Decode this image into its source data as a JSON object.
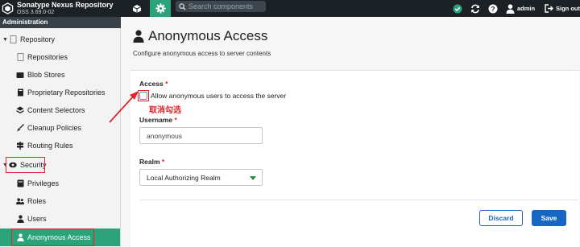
{
  "header": {
    "app_name": "Sonatype Nexus Repository",
    "version": "OSS 3.69.0-02",
    "search_placeholder": "Search components",
    "user_name": "admin",
    "signout_label": "Sign out"
  },
  "sidebar": {
    "section_title": "Administration",
    "items": [
      {
        "label": "Repository",
        "icon": "repository-icon"
      },
      {
        "label": "Repositories",
        "icon": "repositories-icon"
      },
      {
        "label": "Blob Stores",
        "icon": "blob-stores-icon"
      },
      {
        "label": "Proprietary Repositories",
        "icon": "proprietary-icon"
      },
      {
        "label": "Content Selectors",
        "icon": "content-selectors-icon"
      },
      {
        "label": "Cleanup Policies",
        "icon": "cleanup-icon"
      },
      {
        "label": "Routing Rules",
        "icon": "routing-icon"
      },
      {
        "label": "Security",
        "icon": "security-icon"
      },
      {
        "label": "Privileges",
        "icon": "privileges-icon"
      },
      {
        "label": "Roles",
        "icon": "roles-icon"
      },
      {
        "label": "Users",
        "icon": "users-icon"
      },
      {
        "label": "Anonymous Access",
        "icon": "anonymous-icon"
      }
    ]
  },
  "page": {
    "title": "Anonymous Access",
    "description": "Configure anonymous access to server contents"
  },
  "form": {
    "access_label": "Access",
    "required_mark": "*",
    "checkbox_label": "Allow anonymous users to access the server",
    "annotation": "取消勾选",
    "username_label": "Username",
    "username_value": "anonymous",
    "realm_label": "Realm",
    "realm_value": "Local Authorizing Realm",
    "discard_label": "Discard",
    "save_label": "Save"
  },
  "colors": {
    "topbar": "#1c2126",
    "accent": "#2aa37a",
    "primary_button": "#1666c5",
    "annotation_red": "#e0262a"
  }
}
